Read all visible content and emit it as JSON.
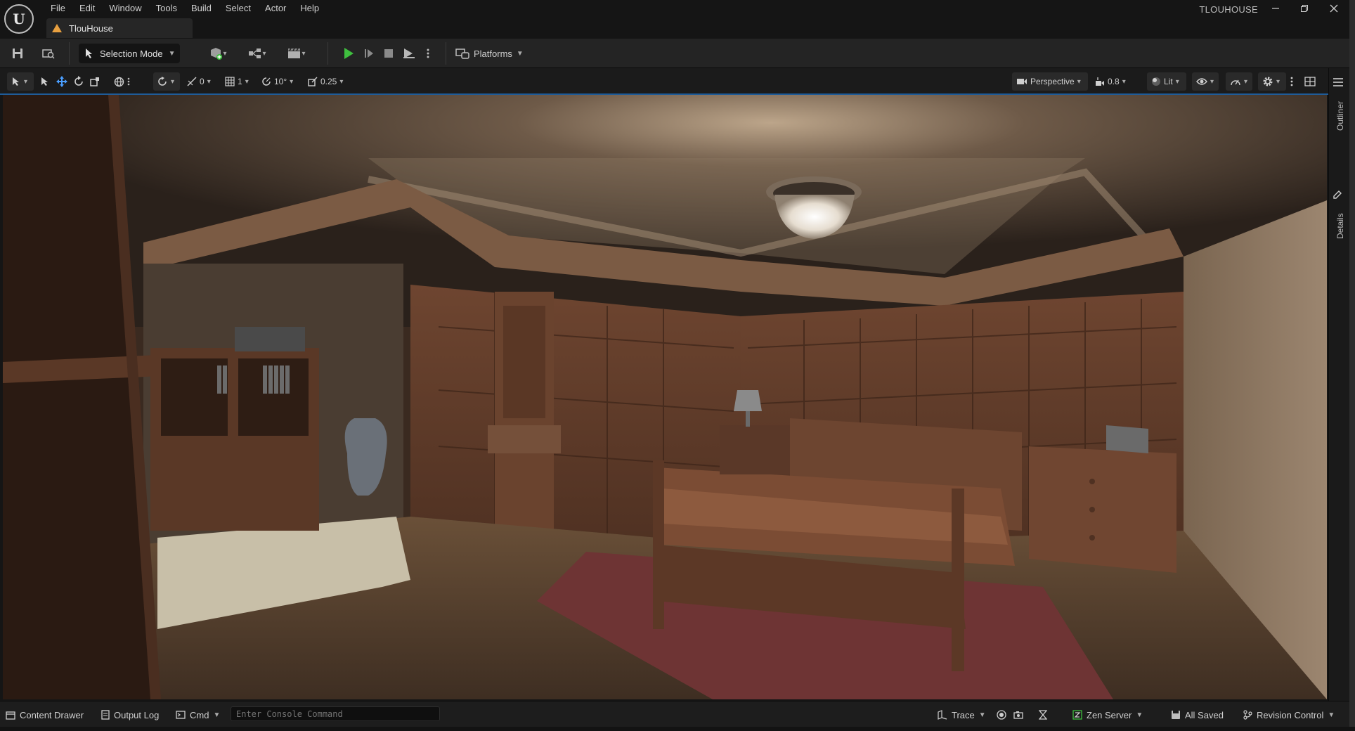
{
  "app": {
    "logo_text": "U",
    "project_name": "TLOUHOUSE",
    "window_controls": [
      "minimize-icon",
      "restore-icon",
      "close-icon"
    ]
  },
  "menu": [
    "File",
    "Edit",
    "Window",
    "Tools",
    "Build",
    "Select",
    "Actor",
    "Help"
  ],
  "document_tab": {
    "label": "TlouHouse",
    "icon": "warning-icon"
  },
  "toolbar": {
    "save_icon": "save-icon",
    "browse_icon": "browse-icon",
    "selection_mode": "Selection Mode",
    "add_actor_icon": "add-actor-icon",
    "blueprint_icon": "blueprint-icon",
    "cinematics_icon": "cinematics-icon",
    "play_icon": "play-icon",
    "advance_frame_icon": "advance-frame-icon",
    "stop_icon": "stop-icon",
    "eject_icon": "eject-icon",
    "platforms": "Platforms"
  },
  "viewport_toolbar": {
    "surface_snap_value": "0",
    "grid_snap_value": "1",
    "rotation_snap_value": "10°",
    "scale_snap_value": "0.25",
    "view_mode": "Perspective",
    "camera_speed": "0.8",
    "lighting_mode": "Lit"
  },
  "side_tabs": [
    "Outliner",
    "Details"
  ],
  "statusbar": {
    "content_drawer": "Content Drawer",
    "output_log": "Output Log",
    "cmd": "Cmd",
    "console_placeholder": "Enter Console Command",
    "trace": "Trace",
    "zen_server": "Zen Server",
    "all_saved": "All Saved",
    "revision_control": "Revision Control"
  },
  "colors": {
    "accent_green": "#3fbf3f",
    "viewport_accent": "#1f5c99",
    "warning": "#e8a040"
  }
}
